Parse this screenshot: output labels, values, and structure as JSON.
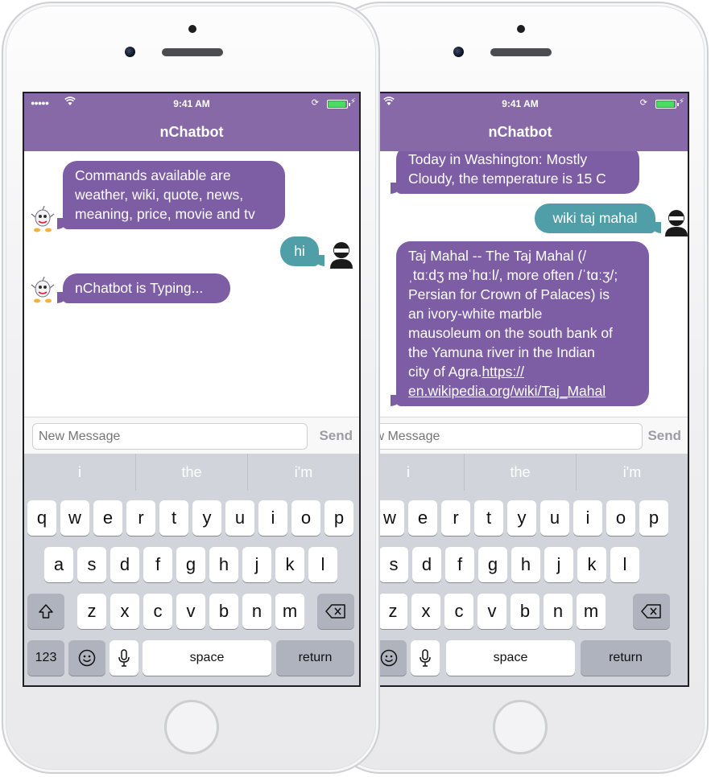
{
  "phones": {
    "left": {
      "status": {
        "time": "9:41 AM",
        "signal": "●●●●●",
        "wifi": "wifi-icon",
        "battery_level": 0.9
      },
      "nav_title": "nChatbot",
      "messages": [
        {
          "from": "bot",
          "lines": [
            "Commands available are",
            "weather, wiki, quote, news,",
            "meaning, price, movie and tv"
          ]
        },
        {
          "from": "user",
          "text": "hi"
        },
        {
          "from": "bot",
          "text": "nChatbot is Typing..."
        }
      ],
      "input_placeholder": "New Message",
      "send_label": "Send",
      "suggestions": [
        "i",
        "the",
        "i'm"
      ]
    },
    "right": {
      "status": {
        "time": "9:41 AM",
        "signal": "●●",
        "wifi": "wifi-icon",
        "battery_level": 0.9
      },
      "nav_title": "nChatbot",
      "messages": [
        {
          "from": "bot",
          "lines": [
            "Today in Washington: Mostly",
            "Cloudy, the temperature is 15 C"
          ]
        },
        {
          "from": "user",
          "text": "wiki taj mahal"
        },
        {
          "from": "bot",
          "lines": [
            "Taj Mahal -- The Taj Mahal (/",
            "ˌtɑːdʒ məˈhɑːl/, more often /ˈtɑːʒ/;",
            "Persian for Crown of Palaces) is",
            "an ivory-white marble",
            "mausoleum on the south bank of",
            "the Yamuna river in the Indian",
            "city of Agra."
          ],
          "link_lines": [
            "https://",
            "en.wikipedia.org/wiki/Taj_Mahal"
          ]
        }
      ],
      "input_placeholder": "New Message",
      "send_label": "Send",
      "suggestions": [
        "i",
        "the",
        "i'm"
      ]
    }
  },
  "keyboard": {
    "row1": [
      "q",
      "w",
      "e",
      "r",
      "t",
      "y",
      "u",
      "i",
      "o",
      "p"
    ],
    "row2": [
      "a",
      "s",
      "d",
      "f",
      "g",
      "h",
      "j",
      "k",
      "l"
    ],
    "row3": [
      "z",
      "x",
      "c",
      "v",
      "b",
      "n",
      "m"
    ],
    "shift_icon": "shift-arrow-icon",
    "delete_icon": "backspace-icon",
    "numbers_label": "123",
    "emoji_icon": "emoji-smiley-icon",
    "mic_icon": "microphone-icon",
    "space_label": "space",
    "return_label": "return"
  },
  "colors": {
    "header": "#8669a6",
    "bot_bubble": "#7d5da3",
    "user_bubble": "#509fa8",
    "keyboard_bg": "#d1d4da",
    "function_key": "#aeb3bd"
  }
}
